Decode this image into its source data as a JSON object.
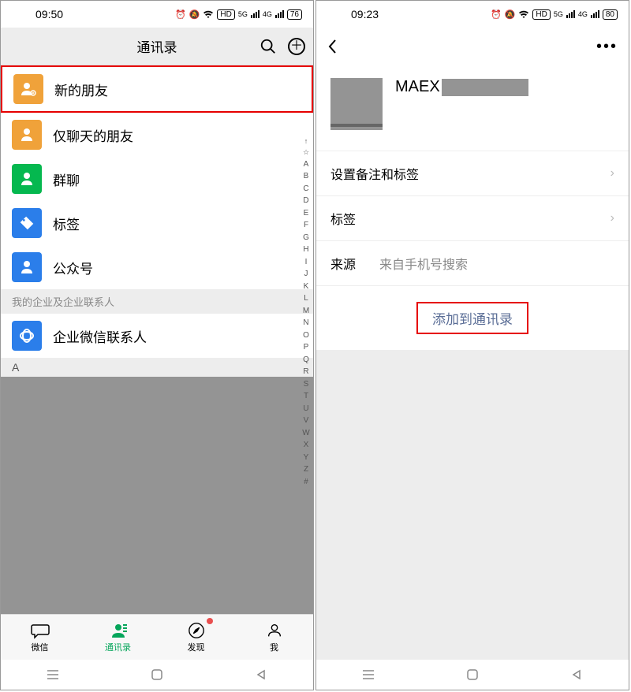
{
  "left": {
    "status": {
      "time": "09:50",
      "hd": "HD",
      "battery": "76"
    },
    "title": "通讯录",
    "rows": {
      "new_friends": "新的朋友",
      "chat_only": "仅聊天的朋友",
      "group_chat": "群聊",
      "tags": "标签",
      "official": "公众号",
      "section_enterprise": "我的企业及企业联系人",
      "enterprise_contacts": "企业微信联系人",
      "letter_a": "A"
    },
    "index_rail": [
      "↑",
      "☆",
      "A",
      "B",
      "C",
      "D",
      "E",
      "F",
      "G",
      "H",
      "I",
      "J",
      "K",
      "L",
      "M",
      "N",
      "O",
      "P",
      "Q",
      "R",
      "S",
      "T",
      "U",
      "V",
      "W",
      "X",
      "Y",
      "Z",
      "#"
    ],
    "tabs": {
      "wechat": "微信",
      "contacts": "通讯录",
      "discover": "发现",
      "me": "我"
    }
  },
  "right": {
    "status": {
      "time": "09:23",
      "hd": "HD",
      "battery": "80"
    },
    "profile": {
      "name": "MAEX"
    },
    "rows": {
      "set_remark": "设置备注和标签",
      "tags": "标签",
      "source_label": "来源",
      "source_value": "来自手机号搜索",
      "add_button": "添加到通讯录"
    }
  }
}
